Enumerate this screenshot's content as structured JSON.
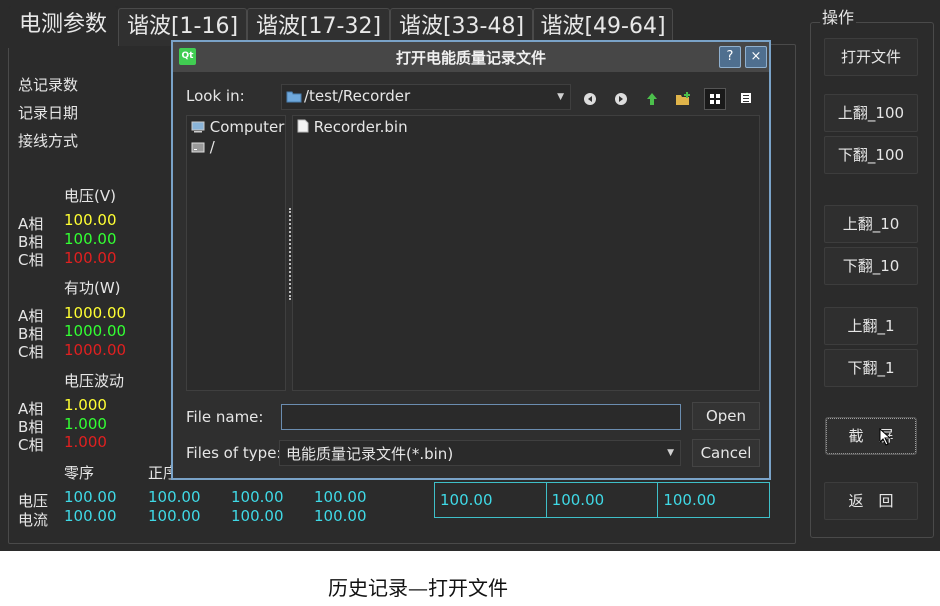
{
  "tabs": [
    "电测参数",
    "谐波[1-16]",
    "谐波[17-32]",
    "谐波[33-48]",
    "谐波[49-64]"
  ],
  "info_labels": [
    "总记录数",
    "记录日期",
    "接线方式"
  ],
  "groups": {
    "voltage": {
      "title": "电压(V)",
      "rows": [
        {
          "phase": "A相",
          "value": "100.00",
          "color": "yellow"
        },
        {
          "phase": "B相",
          "value": "100.00",
          "color": "green"
        },
        {
          "phase": "C相",
          "value": "100.00",
          "color": "red"
        }
      ]
    },
    "active_power": {
      "title": "有功(W)",
      "rows": [
        {
          "phase": "A相",
          "value": "1000.00",
          "color": "yellow"
        },
        {
          "phase": "B相",
          "value": "1000.00",
          "color": "green"
        },
        {
          "phase": "C相",
          "value": "1000.00",
          "color": "red"
        }
      ]
    },
    "fluctuation": {
      "title": "电压波动",
      "rows": [
        {
          "phase": "A相",
          "value": "1.000",
          "color": "yellow"
        },
        {
          "phase": "B相",
          "value": "1.000",
          "color": "green"
        },
        {
          "phase": "C相",
          "value": "1.000",
          "color": "red"
        }
      ]
    }
  },
  "sequence": {
    "headers": [
      "零序",
      "正序"
    ],
    "rows": [
      {
        "label": "电压",
        "values": [
          "100.00",
          "100.00",
          "100.00",
          "100.00"
        ]
      },
      {
        "label": "电流",
        "values": [
          "100.00",
          "100.00",
          "100.00",
          "100.00"
        ]
      }
    ]
  },
  "bottom_table": [
    "100.00",
    "100.00",
    "100.00"
  ],
  "operations": {
    "title": "操作",
    "buttons": [
      "打开文件",
      "上翻_100",
      "下翻_100",
      "上翻_10",
      "下翻_10",
      "上翻_1",
      "下翻_1",
      "截　屏",
      "返　回"
    ]
  },
  "dialog": {
    "title": "打开电能质量记录文件",
    "help": "?",
    "close": "×",
    "look_in_label": "Look in:",
    "look_in_value": "/test/Recorder",
    "sidebar": [
      "Computer",
      "/"
    ],
    "files": [
      "Recorder.bin"
    ],
    "file_name_label": "File name:",
    "file_name_value": "",
    "files_of_type_label": "Files of type:",
    "files_of_type_value": "电能质量记录文件(*.bin)",
    "open_label": "Open",
    "cancel_label": "Cancel"
  },
  "caption": "历史记录—打开文件"
}
